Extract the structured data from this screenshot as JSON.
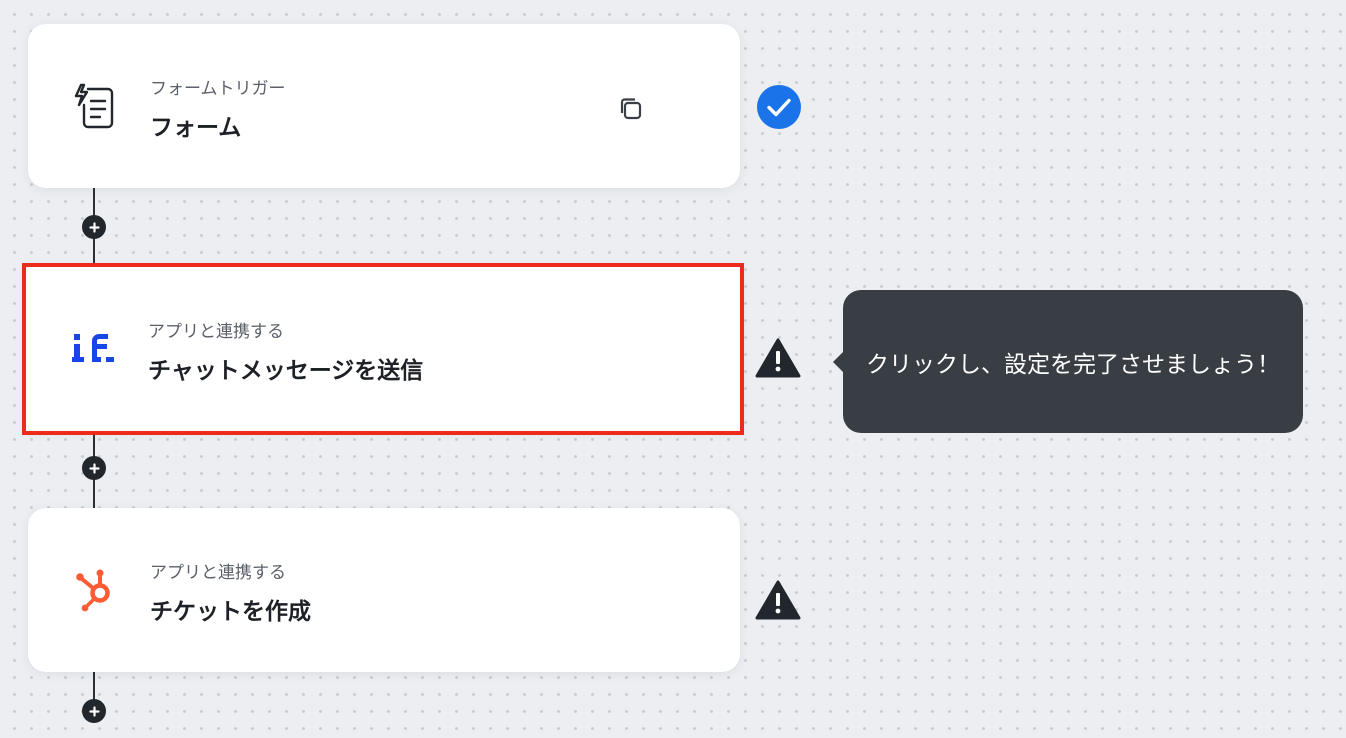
{
  "steps": [
    {
      "category": "フォームトリガー",
      "title": "フォーム",
      "icon": "form-trigger-icon",
      "status": "complete"
    },
    {
      "category": "アプリと連携する",
      "title": "チャットメッセージを送信",
      "icon": "if-logo-icon",
      "status": "warning"
    },
    {
      "category": "アプリと連携する",
      "title": "チケットを作成",
      "icon": "hubspot-icon",
      "status": "warning"
    }
  ],
  "tooltip": {
    "text": "クリックし、設定を完了させましょう！"
  },
  "colors": {
    "complete": "#1a73e8",
    "warning": "#22262d",
    "highlight": "#ee2a1c",
    "if_logo": "#1845e8",
    "hubspot": "#ff5c35",
    "tooltip_bg": "#393d44"
  }
}
